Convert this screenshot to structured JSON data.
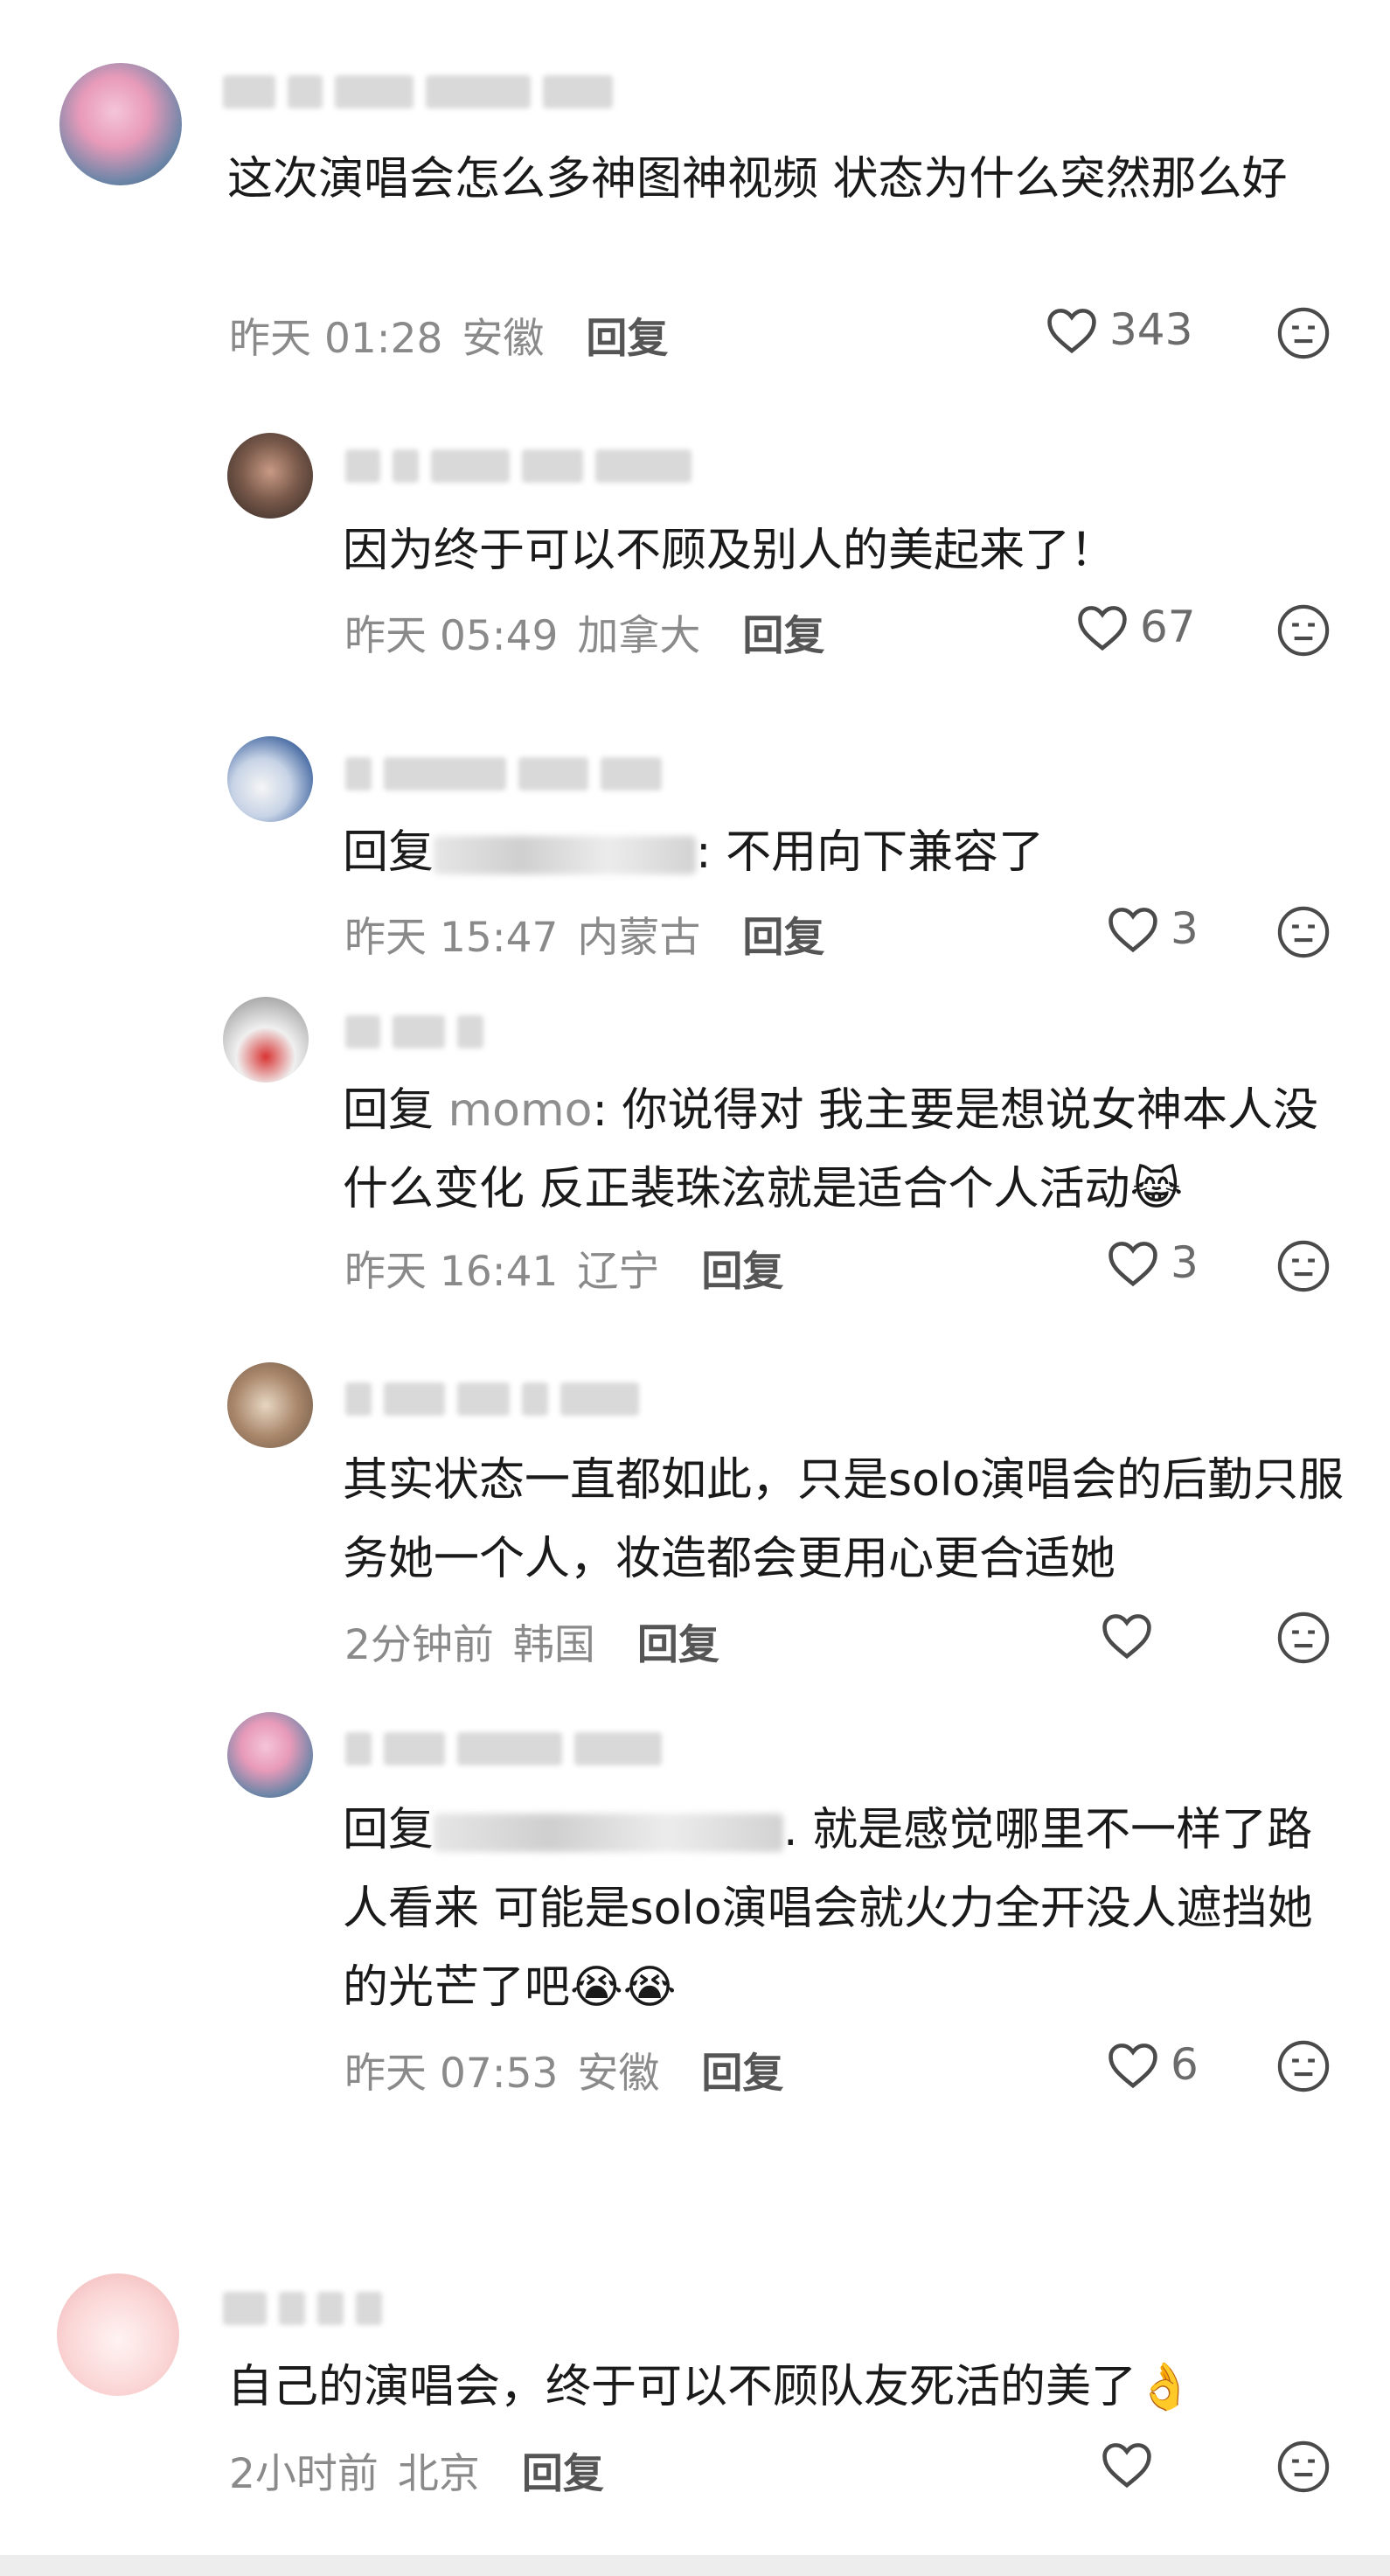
{
  "comments": [
    {
      "text": "这次演唱会怎么多神图神视频 状态为什么突然那么好",
      "time": "昨天 01:28",
      "location": "安徽",
      "reply": "回复",
      "likes": "343"
    },
    {
      "text": "因为终于可以不顾及别人的美起来了！",
      "time": "昨天 05:49",
      "location": "加拿大",
      "reply": "回复",
      "likes": "67"
    },
    {
      "prefix": "回复",
      "suffix": ": 不用向下兼容了",
      "time": "昨天 15:47",
      "location": "内蒙古",
      "reply": "回复",
      "likes": "3"
    },
    {
      "prefix": "回复 ",
      "mention": "momo",
      "suffix": ": 你说得对 我主要是想说女神本人没什么变化 反正裴珠泫就是适合个人活动",
      "emoji": "😹",
      "time": "昨天 16:41",
      "location": "辽宁",
      "reply": "回复",
      "likes": "3"
    },
    {
      "text": "其实状态一直都如此，只是solo演唱会的后勤只服务她一个人，妆造都会更用心更合适她",
      "time": "2分钟前",
      "location": "韩国",
      "reply": "回复",
      "likes": ""
    },
    {
      "prefix": "回复",
      "suffix": ". 就是感觉哪里不一样了路人看来 可能是solo演唱会就火力全开没人遮挡她的光芒了吧",
      "emoji": "😭😭",
      "time": "昨天 07:53",
      "location": "安徽",
      "reply": "回复",
      "likes": "6"
    },
    {
      "text": "自己的演唱会，终于可以不顾队友死活的美了",
      "emoji": "👌",
      "time": "2小时前",
      "location": "北京",
      "reply": "回复",
      "likes": ""
    }
  ],
  "icons": {
    "like": "heart-outline-icon",
    "dislike": "unamused-face-icon"
  }
}
